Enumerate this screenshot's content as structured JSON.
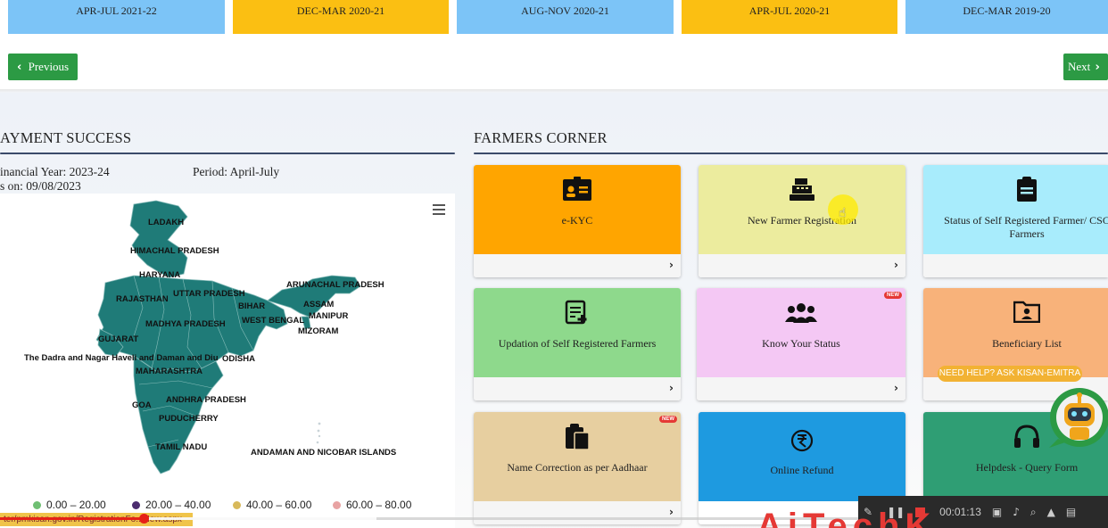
{
  "installments": [
    {
      "period": "APR-JUL 2021-22",
      "color": "#7cc4f7"
    },
    {
      "period": "DEC-MAR 2020-21",
      "color": "#fbbf12"
    },
    {
      "period": "AUG-NOV 2020-21",
      "color": "#7cc4f7"
    },
    {
      "period": "APR-JUL 2020-21",
      "color": "#fbbf12"
    },
    {
      "period": "DEC-MAR 2019-20",
      "color": "#7cc4f7"
    }
  ],
  "nav": {
    "previous": "Previous",
    "next": "Next"
  },
  "payment": {
    "title": "AYMENT SUCCESS",
    "financial_year": "inancial Year: 2023-24",
    "period": "Period: April-July",
    "as_on": "s on: 09/08/2023",
    "menu_icon": "hamburger-menu-icon",
    "map_labels": {
      "ladakh": "LADAKH",
      "himachal": "HIMACHAL PRADESH",
      "haryana": "HARYANA",
      "rajasthan": "RAJASTHAN",
      "uttar_pradesh": "UTTAR PRADESH",
      "bihar": "BIHAR",
      "arunachal": "ARUNACHAL PRADESH",
      "assam": "ASSAM",
      "west_bengal": "WEST BENGAL",
      "manipur": "MANIPUR",
      "mizoram": "MIZORAM",
      "madhya_pradesh": "MADHYA PRADESH",
      "gujarat": "GUJARAT",
      "dadra": "The Dadra and Nagar Haveli and Daman and Diu",
      "odisha": "ODISHA",
      "maharashtra": "MAHARASHTRA",
      "andhra": "ANDHRA PRADESH",
      "goa": "GOA",
      "puducherry": "PUDUCHERRY",
      "tamil_nadu": "TAMIL NADU",
      "andaman": "ANDAMAN AND NICOBAR ISLANDS"
    },
    "legend": [
      {
        "label": "0.00 – 20.00",
        "color": "#6fbf73"
      },
      {
        "label": "20.00 – 40.00",
        "color": "#4b2c6e"
      },
      {
        "label": "40.00 – 60.00",
        "color": "#d8b95a"
      },
      {
        "label": "60.00 – 80.00",
        "color": "#e8a3a3"
      }
    ],
    "map_fill": "#1f7b78"
  },
  "farmers_corner": {
    "title": "FARMERS CORNER",
    "tiles": [
      {
        "label": "e-KYC",
        "icon": "id-card-icon",
        "color": "#ffa500"
      },
      {
        "label": "New Farmer Registration",
        "icon": "cash-register-icon",
        "color": "#ecec9e"
      },
      {
        "label": "Status of Self Registered Farmer/ CSC Farmers",
        "icon": "clipboard-icon",
        "color": "#a8ecfc"
      },
      {
        "label": "Updation of Self Registered Farmers",
        "icon": "edit-document-icon",
        "color": "#8ed98c"
      },
      {
        "label": "Know Your Status",
        "icon": "users-icon",
        "color": "#f4c8f4",
        "badge": "NEW"
      },
      {
        "label": "Beneficiary List",
        "icon": "folder-user-icon",
        "color": "#f8b27a"
      },
      {
        "label": "Name Correction as per Aadhaar",
        "icon": "paste-icon",
        "color": "#e7cfa0",
        "badge": "NEW"
      },
      {
        "label": "Online Refund",
        "icon": "rupee-refund-icon",
        "color": "#1e9ae0"
      },
      {
        "label": "Helpdesk - Query Form",
        "icon": "headphones-icon",
        "color": "#2f9e74"
      }
    ],
    "help_badge": "NEED HELP? ASK KISAN-EMITRA"
  },
  "video": {
    "url_text": "ter/pmkisan.gov.in/RegistrationFo...New.aspx",
    "time": "00:01:13",
    "progress": 0.13,
    "buffered": 0.34
  }
}
